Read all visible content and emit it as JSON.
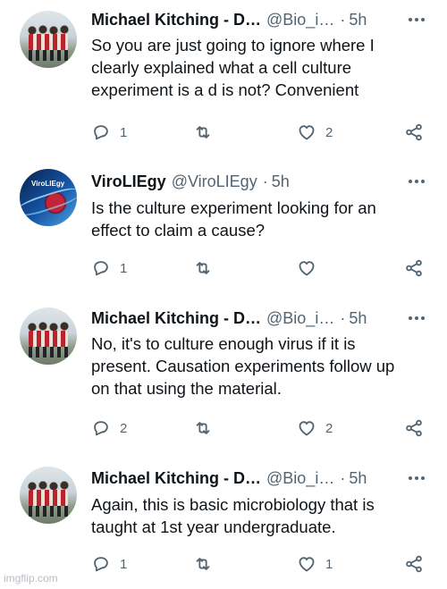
{
  "tweets": [
    {
      "avatar": "group-photo-flag",
      "name": "Michael Kitching - D…",
      "handle": "@Bio_i…",
      "dot": "·",
      "time": "5h",
      "text": [
        "So you are just going to ignore where I",
        "clearly explained what a cell culture",
        "experiment is a d is not? Convenient"
      ],
      "replies": "1",
      "retweets": "",
      "likes": "2"
    },
    {
      "avatar": "virus-dna-logo",
      "avatar_text": "ViroLIEgy",
      "name": "ViroLIEgy",
      "handle": "@ViroLIEgy",
      "dot": "·",
      "time": "5h",
      "text": [
        "Is the culture experiment looking for an",
        "effect to claim a cause?"
      ],
      "replies": "1",
      "retweets": "",
      "likes": ""
    },
    {
      "avatar": "group-photo-flag",
      "name": "Michael Kitching - D…",
      "handle": "@Bio_i…",
      "dot": "·",
      "time": "5h",
      "text": [
        "No, it's to culture enough virus if it is",
        "present. Causation experiments follow up",
        "on that using the material."
      ],
      "replies": "2",
      "retweets": "",
      "likes": "2"
    },
    {
      "avatar": "group-photo-flag",
      "name": "Michael Kitching - D…",
      "handle": "@Bio_i…",
      "dot": "·",
      "time": "5h",
      "text": [
        "Again,  this is basic microbiology that is",
        "taught at 1st year undergraduate."
      ],
      "replies": "1",
      "retweets": "",
      "likes": "1"
    }
  ],
  "icons": {
    "more": "more-horizontal-icon",
    "reply": "reply-bubble-icon",
    "retweet": "retweet-icon",
    "like": "heart-icon",
    "share": "share-icon"
  },
  "watermark": "imgflip.com"
}
